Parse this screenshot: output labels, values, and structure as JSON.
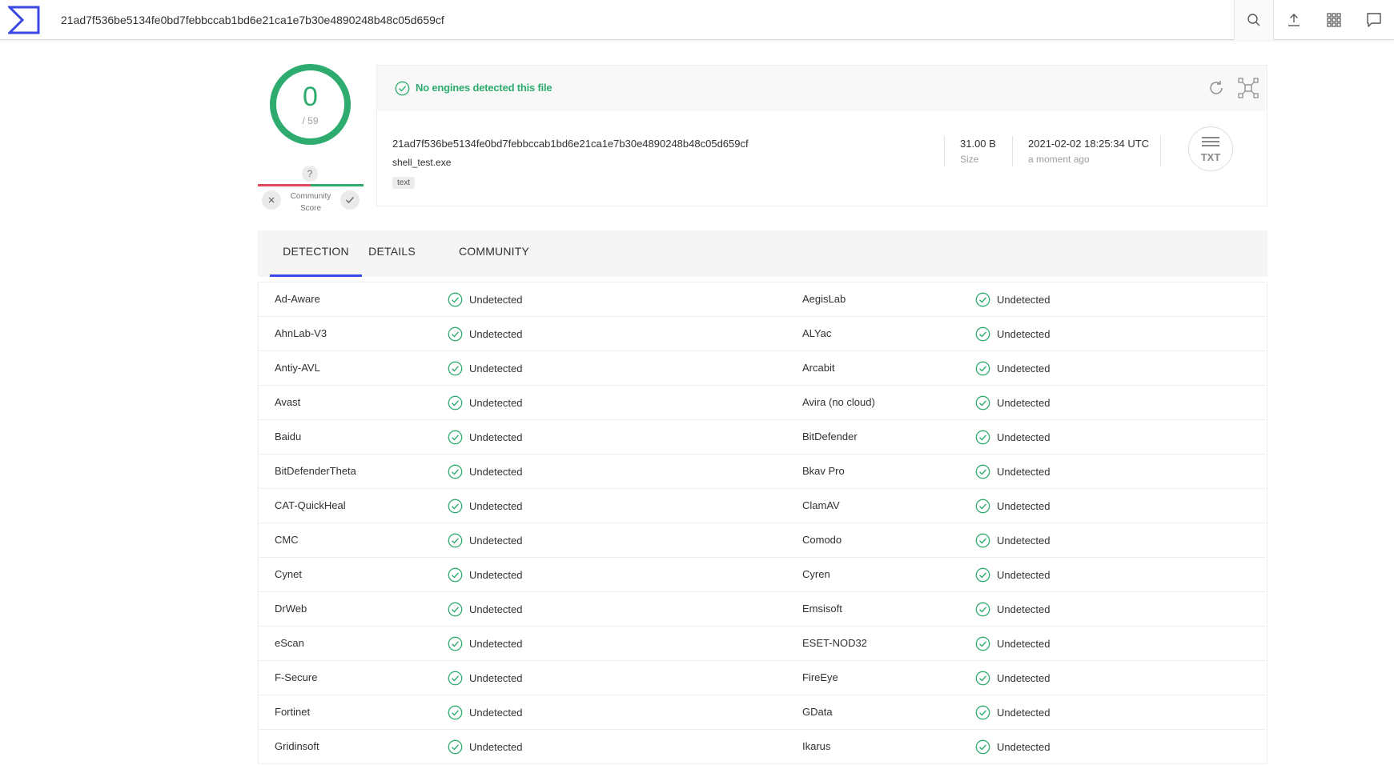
{
  "search": {
    "value": "21ad7f536be5134fe0bd7febbccab1bd6e21ca1e7b30e4890248b48c05d659cf"
  },
  "toolbar": {
    "icons": [
      "search-icon",
      "upload-icon",
      "apps-grid-icon",
      "chat-icon"
    ]
  },
  "score": {
    "detections": "0",
    "total": "/ 59",
    "community_question": "?",
    "community_label_1": "Community",
    "community_label_2": "Score"
  },
  "summary": {
    "status": "No engines detected this file",
    "hash": "21ad7f536be5134fe0bd7febbccab1bd6e21ca1e7b30e4890248b48c05d659cf",
    "file_name": "shell_test.exe",
    "tag": "text",
    "size_value": "31.00 B",
    "size_label": "Size",
    "date_value": "2021-02-02 18:25:34 UTC",
    "date_label": "a moment ago",
    "file_type": "TXT"
  },
  "tabs": [
    {
      "label": "DETECTION",
      "active": true
    },
    {
      "label": "DETAILS",
      "active": false
    },
    {
      "label": "COMMUNITY",
      "active": false
    }
  ],
  "colors": {
    "clean": "#2eab6e",
    "malicious": "#e0475a",
    "accent": "#3a48e6"
  },
  "detections": [
    [
      {
        "engine": "Ad-Aware",
        "result": "Undetected"
      },
      {
        "engine": "AegisLab",
        "result": "Undetected"
      }
    ],
    [
      {
        "engine": "AhnLab-V3",
        "result": "Undetected"
      },
      {
        "engine": "ALYac",
        "result": "Undetected"
      }
    ],
    [
      {
        "engine": "Antiy-AVL",
        "result": "Undetected"
      },
      {
        "engine": "Arcabit",
        "result": "Undetected"
      }
    ],
    [
      {
        "engine": "Avast",
        "result": "Undetected"
      },
      {
        "engine": "Avira (no cloud)",
        "result": "Undetected"
      }
    ],
    [
      {
        "engine": "Baidu",
        "result": "Undetected"
      },
      {
        "engine": "BitDefender",
        "result": "Undetected"
      }
    ],
    [
      {
        "engine": "BitDefenderTheta",
        "result": "Undetected"
      },
      {
        "engine": "Bkav Pro",
        "result": "Undetected"
      }
    ],
    [
      {
        "engine": "CAT-QuickHeal",
        "result": "Undetected"
      },
      {
        "engine": "ClamAV",
        "result": "Undetected"
      }
    ],
    [
      {
        "engine": "CMC",
        "result": "Undetected"
      },
      {
        "engine": "Comodo",
        "result": "Undetected"
      }
    ],
    [
      {
        "engine": "Cynet",
        "result": "Undetected"
      },
      {
        "engine": "Cyren",
        "result": "Undetected"
      }
    ],
    [
      {
        "engine": "DrWeb",
        "result": "Undetected"
      },
      {
        "engine": "Emsisoft",
        "result": "Undetected"
      }
    ],
    [
      {
        "engine": "eScan",
        "result": "Undetected"
      },
      {
        "engine": "ESET-NOD32",
        "result": "Undetected"
      }
    ],
    [
      {
        "engine": "F-Secure",
        "result": "Undetected"
      },
      {
        "engine": "FireEye",
        "result": "Undetected"
      }
    ],
    [
      {
        "engine": "Fortinet",
        "result": "Undetected"
      },
      {
        "engine": "GData",
        "result": "Undetected"
      }
    ],
    [
      {
        "engine": "Gridinsoft",
        "result": "Undetected"
      },
      {
        "engine": "Ikarus",
        "result": "Undetected"
      }
    ]
  ]
}
